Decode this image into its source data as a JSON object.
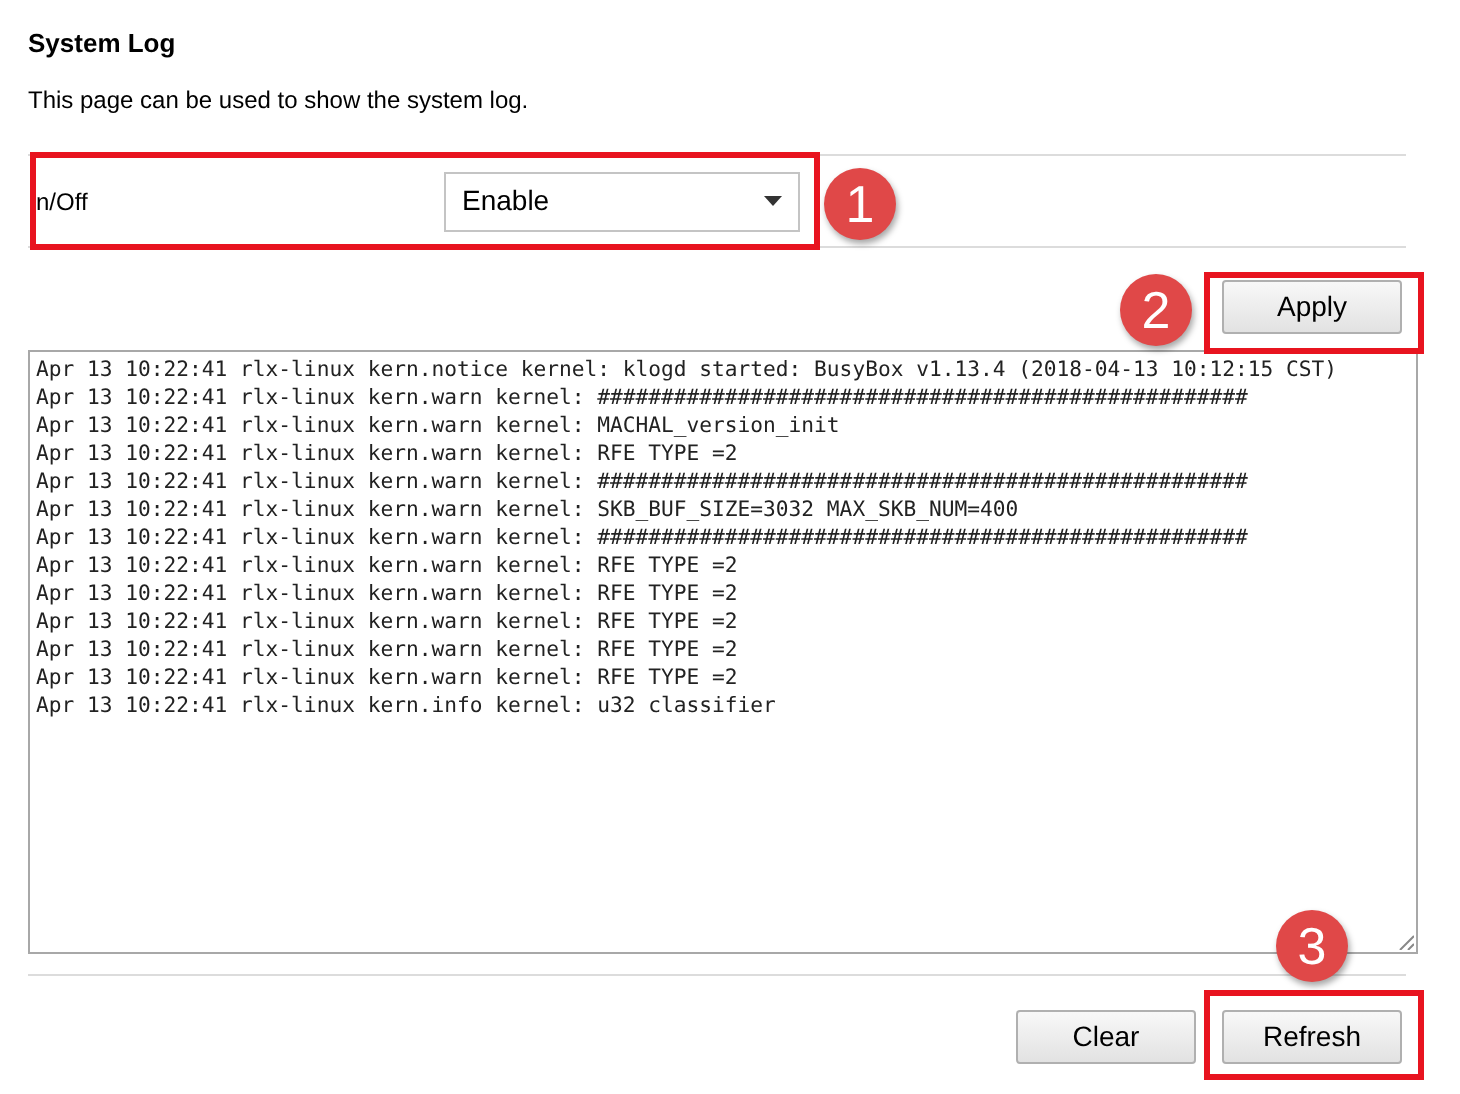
{
  "title": "System Log",
  "description": "This page can be used to show the system log.",
  "on_off": {
    "label": "n/Off",
    "value": "Enable"
  },
  "apply_button": "Apply",
  "log_lines": [
    "Apr 13 10:22:41 rlx-linux kern.notice kernel: klogd started: BusyBox v1.13.4 (2018-04-13 10:12:15 CST)",
    "Apr 13 10:22:41 rlx-linux kern.warn kernel: ###################################################",
    "Apr 13 10:22:41 rlx-linux kern.warn kernel: MACHAL_version_init",
    "Apr 13 10:22:41 rlx-linux kern.warn kernel: RFE TYPE =2",
    "Apr 13 10:22:41 rlx-linux kern.warn kernel: ###################################################",
    "Apr 13 10:22:41 rlx-linux kern.warn kernel: SKB_BUF_SIZE=3032 MAX_SKB_NUM=400",
    "Apr 13 10:22:41 rlx-linux kern.warn kernel: ###################################################",
    "Apr 13 10:22:41 rlx-linux kern.warn kernel: RFE TYPE =2",
    "Apr 13 10:22:41 rlx-linux kern.warn kernel: RFE TYPE =2",
    "Apr 13 10:22:41 rlx-linux kern.warn kernel: RFE TYPE =2",
    "Apr 13 10:22:41 rlx-linux kern.warn kernel: RFE TYPE =2",
    "Apr 13 10:22:41 rlx-linux kern.warn kernel: RFE TYPE =2",
    "Apr 13 10:22:41 rlx-linux kern.info kernel: u32 classifier"
  ],
  "buttons": [
    "Clear",
    "Refresh"
  ],
  "annotations": [
    "1",
    "2",
    "3"
  ]
}
